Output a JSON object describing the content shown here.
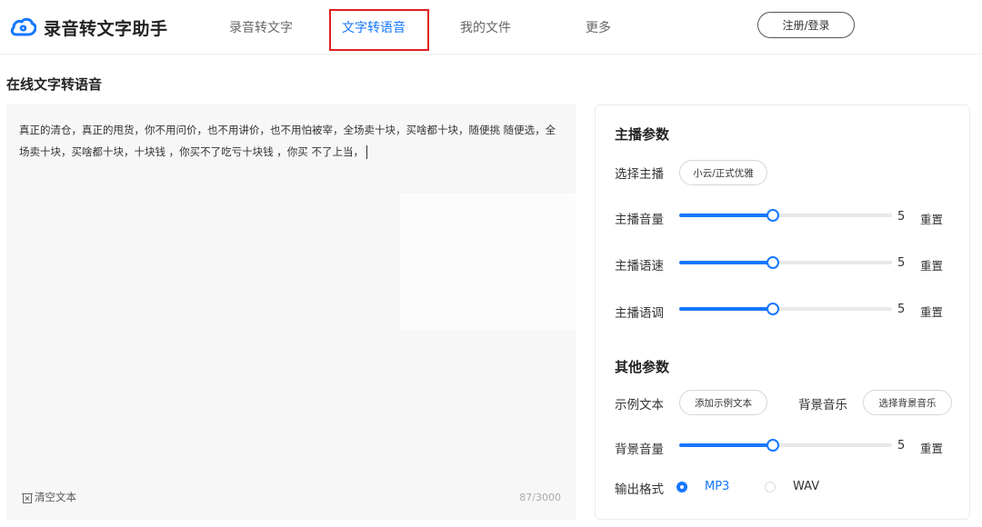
{
  "app": {
    "name": "录音转文字助手",
    "accent_color": "#1677ff",
    "highlight_color": "#e02020"
  },
  "nav": {
    "items": [
      {
        "label": "录音转文字",
        "active": false
      },
      {
        "label": "文字转语音",
        "active": true
      },
      {
        "label": "我的文件",
        "active": false
      },
      {
        "label": "更多",
        "active": false
      }
    ],
    "login_label": "注册/登录"
  },
  "page": {
    "title": "在线文字转语音"
  },
  "editor": {
    "text": "真正的清仓，真正的甩货，你不用问价，也不用讲价，也不用怕被宰，全场卖十块，买啥都十块，随便挑 随便选，全场卖十块，买啥都十块，十块钱 ，你买不了吃亏十块钱 ，你买 不了上当，",
    "clear_label": "清空文本",
    "clear_icon": "trash-icon",
    "counter": "87/3000"
  },
  "anchor": {
    "title": "主播参数",
    "select_label": "选择主播",
    "selected_anchor": "小云/正式优雅",
    "sliders": [
      {
        "label": "主播音量",
        "value": "5",
        "fraction": 0.44,
        "reset_label": "重置"
      },
      {
        "label": "主播语速",
        "value": "5",
        "fraction": 0.44,
        "reset_label": "重置"
      },
      {
        "label": "主播语调",
        "value": "5",
        "fraction": 0.44,
        "reset_label": "重置"
      }
    ]
  },
  "other": {
    "title": "其他参数",
    "sample_label": "示例文本",
    "sample_button": "添加示例文本",
    "bgm_label": "背景音乐",
    "bgm_button": "选择背景音乐",
    "bgm_volume": {
      "label": "背景音量",
      "value": "5",
      "fraction": 0.44,
      "reset_label": "重置"
    },
    "format_label": "输出格式",
    "formats": [
      {
        "label": "MP3",
        "selected": true
      },
      {
        "label": "WAV",
        "selected": false
      }
    ]
  }
}
